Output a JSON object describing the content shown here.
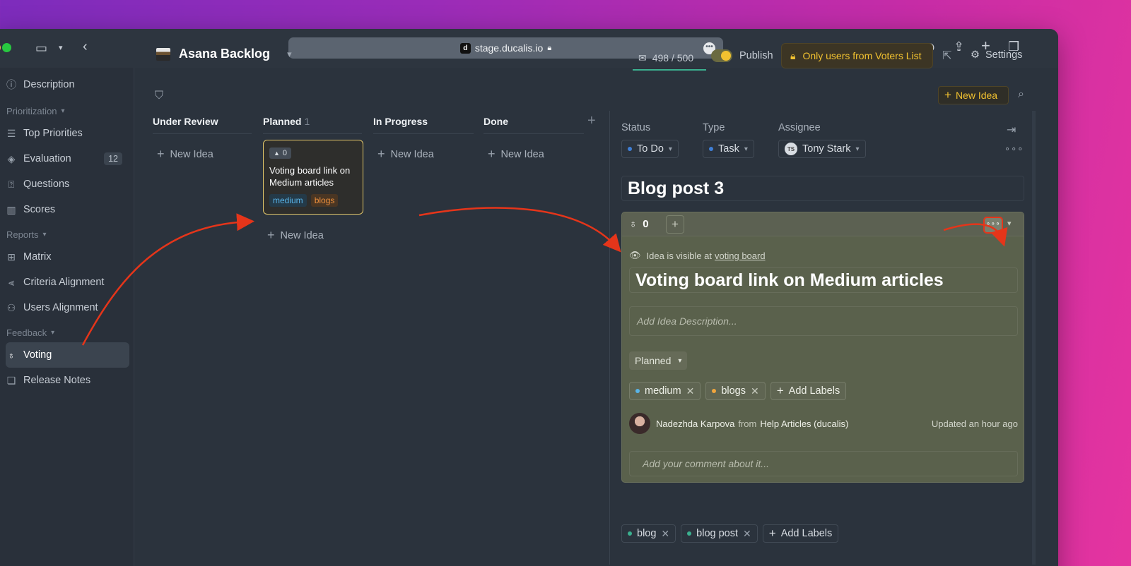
{
  "browser": {
    "url": "stage.ducalis.io",
    "favicon_letter": "d"
  },
  "sidebar": {
    "items_top": [
      {
        "label": "Description",
        "icon": "info-icon"
      }
    ],
    "sections": {
      "prioritization": "Prioritization",
      "reports": "Reports",
      "feedback": "Feedback"
    },
    "prioritization_items": [
      {
        "label": "Top Priorities",
        "icon": "list-icon"
      },
      {
        "label": "Evaluation",
        "icon": "diamond-icon",
        "badge": "12"
      },
      {
        "label": "Questions",
        "icon": "question-icon"
      },
      {
        "label": "Scores",
        "icon": "scores-icon"
      }
    ],
    "reports_items": [
      {
        "label": "Matrix",
        "icon": "grid-icon"
      },
      {
        "label": "Criteria Alignment",
        "icon": "align-icon"
      },
      {
        "label": "Users Alignment",
        "icon": "users-icon"
      }
    ],
    "feedback_items": [
      {
        "label": "Voting",
        "icon": "bulb-icon",
        "active": true
      },
      {
        "label": "Release Notes",
        "icon": "notes-icon"
      }
    ]
  },
  "header": {
    "project": "Asana Backlog",
    "votes": "498 / 500",
    "publish": "Publish",
    "publish_on": true,
    "voters_button": "Only users from Voters List",
    "settings": "Settings",
    "new_idea": "New Idea",
    "accent": "#f2c230"
  },
  "board": {
    "columns": [
      {
        "title": "Under Review",
        "count": "",
        "new_label": "New Idea"
      },
      {
        "title": "Planned",
        "count": "1",
        "new_label": "New Idea"
      },
      {
        "title": "In Progress",
        "count": "",
        "new_label": "New Idea"
      },
      {
        "title": "Done",
        "count": "",
        "new_label": "New Idea"
      }
    ],
    "card": {
      "votes": "0",
      "title": "Voting board link on Medium articles",
      "tags": [
        "medium",
        "blogs"
      ]
    }
  },
  "panel": {
    "status_label": "Status",
    "status_value": "To Do",
    "type_label": "Type",
    "type_value": "Task",
    "assignee_label": "Assignee",
    "assignee_initials": "TS",
    "assignee_value": "Tony Stark",
    "title": "Blog post 3",
    "idea": {
      "votes": "0",
      "visible_text": "Idea is visible at",
      "visible_link": "voting board",
      "title": "Voting board  link on Medium articles",
      "description_placeholder": "Add Idea Description...",
      "status": "Planned",
      "labels": [
        {
          "name": "medium",
          "color": "#59b4e8"
        },
        {
          "name": "blogs",
          "color": "#f0a53d"
        }
      ],
      "add_labels": "Add Labels",
      "author": "Nadezhda Karpova",
      "from_word": "from",
      "source": "Help Articles (ducalis)",
      "updated": "Updated an hour ago",
      "comment_placeholder": "Add your comment about it..."
    },
    "task_labels": [
      {
        "name": "blog",
        "color": "#3bb08f"
      },
      {
        "name": "blog post",
        "color": "#3bb08f"
      }
    ],
    "add_labels": "Add Labels"
  }
}
